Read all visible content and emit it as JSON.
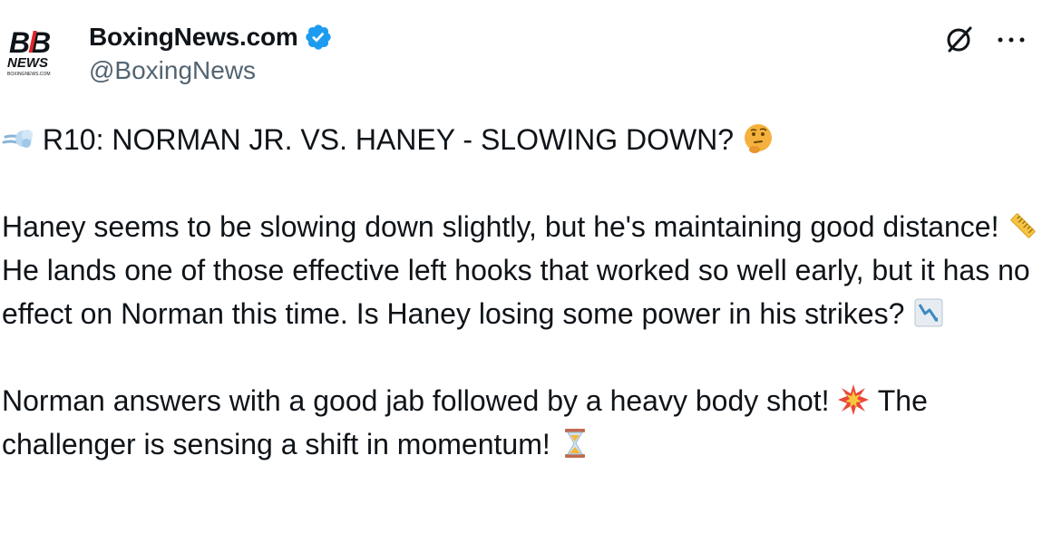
{
  "account": {
    "display_name": "BoxingNews.com",
    "handle": "@BoxingNews",
    "verified": true,
    "logo_text_top": "BB",
    "logo_text_middle": "NEWS",
    "logo_text_bottom": "BOXINGNEWS.COM"
  },
  "actions": {
    "grok_icon": "grok-slash-circle-icon",
    "more_icon": "more-horizontal-icon"
  },
  "tweet": {
    "headline": "R10: NORMAN JR. VS. HANEY - SLOWING DOWN?",
    "para1_a": "Haney seems to be slowing down slightly, but he's maintaining good distance!",
    "para1_b": "He lands one of those effective left hooks that worked so well early, but it has no effect on Norman this time. Is Haney losing some power in his strikes?",
    "para2_a": "Norman answers with a good jab followed by a heavy body shot!",
    "para2_b": "The challenger is sensing a shift in momentum!"
  },
  "emojis": {
    "headline_lead": "dashing-away-emoji",
    "headline_trail": "thinking-face-emoji",
    "para1_a": "straight-ruler-emoji",
    "para1_b": "chart-decreasing-emoji",
    "para2_a": "collision-emoji",
    "para2_b": "hourglass-emoji"
  },
  "colors": {
    "text": "#0f1419",
    "secondary": "#536471",
    "verified": "#1d9bf0",
    "logo_red": "#e0262b"
  }
}
